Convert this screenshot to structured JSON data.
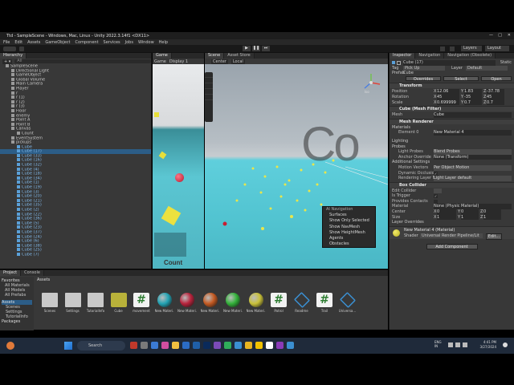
{
  "window": {
    "title": "Ttd - SampleScene - Windows, Mac, Linux - Unity 2022.3.14f1 <DX11>",
    "menus": [
      "File",
      "Edit",
      "Assets",
      "GameObject",
      "Component",
      "Services",
      "Jobs",
      "Window",
      "Help"
    ],
    "layers_label": "Layers",
    "layout_label": "Layout"
  },
  "hierarchy": {
    "tab": "Hierarchy",
    "search_placeholder": "All",
    "items": [
      {
        "label": "SampleScene",
        "indent": 1,
        "blue": false,
        "sel": false
      },
      {
        "label": "Directional Light",
        "indent": 2,
        "blue": false,
        "sel": false
      },
      {
        "label": "GameObject",
        "indent": 2,
        "blue": false,
        "sel": false
      },
      {
        "label": "Global Volume",
        "indent": 2,
        "blue": false,
        "sel": false
      },
      {
        "label": "Main Camera",
        "indent": 2,
        "blue": false,
        "sel": false
      },
      {
        "label": "Player",
        "indent": 2,
        "blue": false,
        "sel": false
      },
      {
        "label": "r",
        "indent": 2,
        "blue": false,
        "sel": false
      },
      {
        "label": "r (1)",
        "indent": 2,
        "blue": false,
        "sel": false
      },
      {
        "label": "r (2)",
        "indent": 2,
        "blue": false,
        "sel": false
      },
      {
        "label": "r (3)",
        "indent": 2,
        "blue": false,
        "sel": false
      },
      {
        "label": "Floor",
        "indent": 2,
        "blue": false,
        "sel": false
      },
      {
        "label": "enemy",
        "indent": 2,
        "blue": false,
        "sel": false
      },
      {
        "label": "Point A",
        "indent": 2,
        "blue": false,
        "sel": false
      },
      {
        "label": "Point B",
        "indent": 2,
        "blue": false,
        "sel": false
      },
      {
        "label": "Canvas",
        "indent": 2,
        "blue": false,
        "sel": false
      },
      {
        "label": "Count",
        "indent": 3,
        "blue": false,
        "sel": false
      },
      {
        "label": "EventSystem",
        "indent": 2,
        "blue": false,
        "sel": false
      },
      {
        "label": "pickups",
        "indent": 2,
        "blue": false,
        "sel": false
      },
      {
        "label": "Cube",
        "indent": 3,
        "blue": true,
        "sel": false
      },
      {
        "label": "Cube (17)",
        "indent": 3,
        "blue": true,
        "sel": true
      },
      {
        "label": "Cube (33)",
        "indent": 3,
        "blue": true,
        "sel": false
      },
      {
        "label": "Cube (16)",
        "indent": 3,
        "blue": true,
        "sel": false
      },
      {
        "label": "Cube (32)",
        "indent": 3,
        "blue": true,
        "sel": false
      },
      {
        "label": "Cube (4)",
        "indent": 3,
        "blue": true,
        "sel": false
      },
      {
        "label": "Cube (18)",
        "indent": 3,
        "blue": true,
        "sel": false
      },
      {
        "label": "Cube (34)",
        "indent": 3,
        "blue": true,
        "sel": false
      },
      {
        "label": "Cube (1)",
        "indent": 3,
        "blue": true,
        "sel": false
      },
      {
        "label": "Cube (19)",
        "indent": 3,
        "blue": true,
        "sel": false
      },
      {
        "label": "Cube (3)",
        "indent": 3,
        "blue": true,
        "sel": false
      },
      {
        "label": "Cube (20)",
        "indent": 3,
        "blue": true,
        "sel": false
      },
      {
        "label": "Cube (21)",
        "indent": 3,
        "blue": true,
        "sel": false
      },
      {
        "label": "Cube (35)",
        "indent": 3,
        "blue": true,
        "sel": false
      },
      {
        "label": "Cube (2)",
        "indent": 3,
        "blue": true,
        "sel": false
      },
      {
        "label": "Cube (22)",
        "indent": 3,
        "blue": true,
        "sel": false
      },
      {
        "label": "Cube (36)",
        "indent": 3,
        "blue": true,
        "sel": false
      },
      {
        "label": "Cube (5)",
        "indent": 3,
        "blue": true,
        "sel": false
      },
      {
        "label": "Cube (23)",
        "indent": 3,
        "blue": true,
        "sel": false
      },
      {
        "label": "Cube (37)",
        "indent": 3,
        "blue": true,
        "sel": false
      },
      {
        "label": "Cube (24)",
        "indent": 3,
        "blue": true,
        "sel": false
      },
      {
        "label": "Cube (6)",
        "indent": 3,
        "blue": true,
        "sel": false
      },
      {
        "label": "Cube (38)",
        "indent": 3,
        "blue": true,
        "sel": false
      },
      {
        "label": "Cube (25)",
        "indent": 3,
        "blue": true,
        "sel": false
      },
      {
        "label": "Cube (7)",
        "indent": 3,
        "blue": true,
        "sel": false
      }
    ]
  },
  "game": {
    "tab": "Game",
    "mode": "Game",
    "display": "Display 1",
    "count_text": "Count"
  },
  "scene": {
    "tab": "Scene",
    "asset_store_tab": "Asset Store",
    "pivot": "Center",
    "space": "Local",
    "iso_label": "Iso",
    "bg_text": "Co",
    "nav_menu": {
      "title": "AI Navigation",
      "items": [
        "Surfaces",
        "Show Only Selected",
        "Show NavMesh",
        "Show HeightMesh",
        "Agents",
        "Obstacles"
      ]
    }
  },
  "inspector": {
    "tabs": [
      "Inspector",
      "Navigation",
      "Navigation (Obsolete)"
    ],
    "object_name": "Cube (17)",
    "static_label": "Static",
    "tag_label": "Tag",
    "tag_value": "Pick Up",
    "layer_label": "Layer",
    "layer_value": "Default",
    "prefab_label": "Prefab",
    "prefab_value": "Cube",
    "overrides_label": "Overrides",
    "select_label": "Select",
    "open_label": "Open",
    "transform": {
      "title": "Transform",
      "position": {
        "label": "Position",
        "x": "12.06",
        "y": "1.83",
        "z": "-37.78"
      },
      "rotation": {
        "label": "Rotation",
        "x": "45",
        "y": "-35",
        "z": "45"
      },
      "scale": {
        "label": "Scale",
        "x": "0.699999",
        "y": "0.7",
        "z": "0.7"
      }
    },
    "mesh_filter": {
      "title": "Cube (Mesh Filter)",
      "mesh_label": "Mesh",
      "mesh_value": "Cube"
    },
    "mesh_renderer": {
      "title": "Mesh Renderer",
      "materials_label": "Materials",
      "element0_label": "Element 0",
      "element0_value": "New Material 4",
      "lighting_label": "Lighting",
      "probes_label": "Probes",
      "light_probes_label": "Light Probes",
      "light_probes_value": "Blend Probes",
      "anchor_label": "Anchor Override",
      "anchor_value": "None (Transform)",
      "additional_label": "Additional Settings",
      "motion_label": "Motion Vectors",
      "motion_value": "Per Object Motion",
      "dynamic_label": "Dynamic Occlusion",
      "rendering_label": "Rendering Layer Mask",
      "rendering_value": "Light Layer default"
    },
    "box_collider": {
      "title": "Box Collider",
      "edit_label": "Edit Collider",
      "trigger_label": "Is Trigger",
      "provides_label": "Provides Contacts",
      "material_label": "Material",
      "material_value": "None (Physic Material)",
      "center_label": "Center",
      "center": {
        "x": "0",
        "y": "0",
        "z": "0"
      },
      "size_label": "Size",
      "size": {
        "x": "1",
        "y": "1",
        "z": "1"
      },
      "layer_overrides_label": "Layer Overrides"
    },
    "material": {
      "title": "New Material 4 (Material)",
      "shader_label": "Shader",
      "shader_value": "Universal Render Pipeline/Lit",
      "edit_label": "Edit..."
    },
    "add_component_label": "Add Component"
  },
  "project": {
    "tabs": [
      "Project",
      "Console"
    ],
    "favorites_label": "Favorites",
    "favorites": [
      "All Materials",
      "All Models",
      "All Prefabs"
    ],
    "assets_label": "Assets",
    "tree": [
      "Scenes",
      "Settings",
      "TutorialInfo"
    ],
    "packages_label": "Packages",
    "breadcrumb": "Assets",
    "assets": [
      {
        "label": "Scenes",
        "kind": "folder",
        "color": "#c9c9c9"
      },
      {
        "label": "Settings",
        "kind": "folder",
        "color": "#c9c9c9"
      },
      {
        "label": "TutorialInfo",
        "kind": "folder",
        "color": "#c9c9c9"
      },
      {
        "label": "Cube",
        "kind": "cube",
        "color": "#b9b23a"
      },
      {
        "label": "movement",
        "kind": "script",
        "color": "#2e7d32"
      },
      {
        "label": "New Materi...",
        "kind": "sphere",
        "color": "#23a3b4"
      },
      {
        "label": "New Materi...",
        "kind": "sphere",
        "color": "#b8233c"
      },
      {
        "label": "New Materi...",
        "kind": "sphere",
        "color": "#c45a22"
      },
      {
        "label": "New Materi...",
        "kind": "sphere",
        "color": "#33b23a"
      },
      {
        "label": "New Materi...",
        "kind": "sphere",
        "color": "#c9c13a"
      },
      {
        "label": "Patrol",
        "kind": "script",
        "color": "#2e7d32"
      },
      {
        "label": "Readme",
        "kind": "box",
        "color": "#3b8fd1"
      },
      {
        "label": "Trail",
        "kind": "script",
        "color": "#2e7d32"
      },
      {
        "label": "Universa...",
        "kind": "box",
        "color": "#3b8fd1"
      }
    ]
  },
  "taskbar": {
    "search_placeholder": "Search",
    "lang_top": "ENG",
    "lang_bottom": "IN",
    "time": "4:41 PM",
    "date": "3/27/2024"
  }
}
